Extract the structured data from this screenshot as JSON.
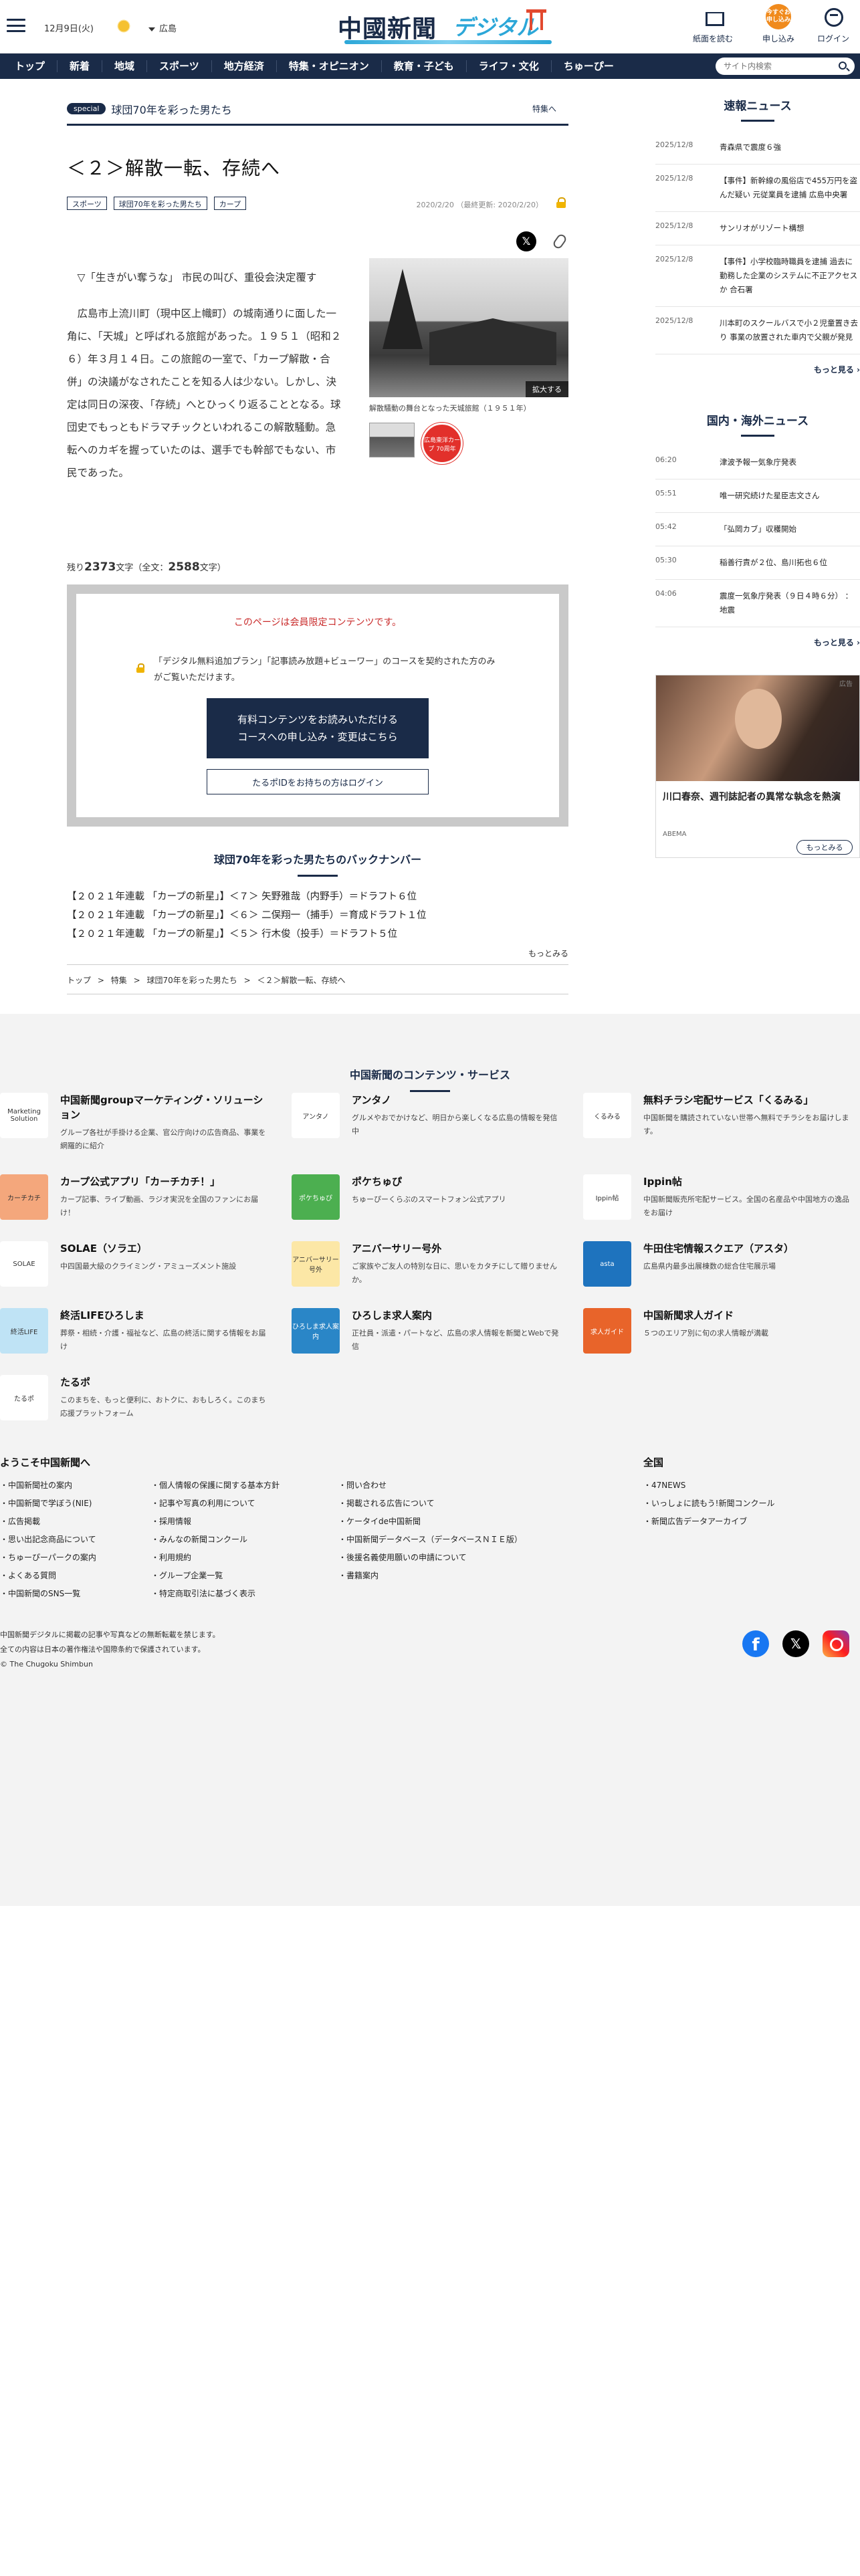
{
  "header": {
    "date": "12月9日(火)",
    "region": "広島",
    "logo_main": "中國新聞",
    "logo_sub": "デジタル",
    "btn_paper": "紙面を読む",
    "btn_apply": "申し込み",
    "apply_badge": "今すぐお申し込み",
    "btn_login": "ログイン"
  },
  "nav": {
    "items": [
      "トップ",
      "新着",
      "地域",
      "スポーツ",
      "地方経済",
      "特集・オピニオン",
      "教育・子ども",
      "ライフ・文化",
      "ちゅーぴー"
    ],
    "search_placeholder": "サイト内検索"
  },
  "article": {
    "special_badge": "special",
    "special_title": "球団70年を彩った男たち",
    "special_link": "特集へ",
    "title": "＜２＞解散一転、存続へ",
    "tags": [
      "スポーツ",
      "球団70年を彩った男たち",
      "カープ"
    ],
    "dates": "2020/2/20 （最終更新: 2020/2/20）",
    "share_x": "𝕏",
    "paragraphs": [
      "▽「生きがい奪うな」 市民の叫び、重役会決定覆す",
      "広島市上流川町（現中区上幟町）の城南通りに面した一角に、「天城」と呼ばれる旅館があった。１９５１（昭和２６）年３月１４日。この旅館の一室で、「カープ解散・合併」の決議がなされたことを知る人は少ない。しかし、決定は同日の深夜、「存続」へとひっくり返ることとなる。球団史でもっともドラマチックといわれるこの解散騒動。急転へのカギを握っていたのは、選手でも幹部でもない、市民であった。"
    ],
    "photo_enlarge": "拡大する",
    "photo_caption": "解散騒動の舞台となった天城旅館（１９５１年）",
    "thumb2_text": "広島東洋カープ 70周年",
    "remaining_prefix": "残り",
    "remaining_count": "2373",
    "remaining_mid": "文字（全文：",
    "total_count": "2588",
    "remaining_suffix": "文字）"
  },
  "paywall": {
    "members_only": "このページは会員限定コンテンツです。",
    "note": "「デジタル無料追加プラン」「記事読み放題+ビューワー」のコースを契約された方のみがご覧いただけます。",
    "primary_button": "有料コンテンツをお読みいただける\nコースへの申し込み・変更はこちら",
    "secondary_button": "たるポIDをお持ちの方はログイン"
  },
  "backnumber": {
    "title": "球団70年を彩った男たちのバックナンバー",
    "items": [
      "【２０２１年連載 「カープの新星」】＜７＞ 矢野雅哉（内野手）＝ドラフト６位",
      "【２０２１年連載 「カープの新星」】＜６＞ 二俣翔一（捕手）＝育成ドラフト１位",
      "【２０２１年連載 「カープの新星」】＜５＞ 行木俊（投手）＝ドラフト５位"
    ],
    "more": "もっとみる"
  },
  "breadcrumb": [
    "トップ",
    ">",
    "特集",
    ">",
    "球団70年を彩った男たち",
    ">",
    "＜２＞解散一転、存続へ"
  ],
  "sidebar": {
    "breaking_title": "速報ニュース",
    "breaking": [
      {
        "date": "2025/12/8",
        "title": "青森県で震度６強"
      },
      {
        "date": "2025/12/8",
        "title": "【事件】新幹線の風俗店で455万円を盗んだ疑い 元従業員を逮捕 広島中央署"
      },
      {
        "date": "2025/12/8",
        "title": "サンリオがリゾート構想"
      },
      {
        "date": "2025/12/8",
        "title": "【事件】小学校臨時職員を逮捕 過去に勤務した企業のシステムに不正アクセスか 合石署"
      },
      {
        "date": "2025/12/8",
        "title": "川本町のスクールバスで小２児童置き去り 事業の放置された車内で父親が発見"
      }
    ],
    "breaking_more": "もっと見る",
    "intl_title": "国内・海外ニュース",
    "intl": [
      {
        "date": "06:20",
        "title": "津波予報一気象庁発表"
      },
      {
        "date": "05:51",
        "title": "唯一研究続けた星臣志文さん"
      },
      {
        "date": "05:42",
        "title": "「弘岡カブ」収穫開始"
      },
      {
        "date": "05:30",
        "title": "稲善行責が２位、島川拓也６位"
      },
      {
        "date": "04:06",
        "title": "震度一気象庁発表（９日４時６分） ：地震"
      }
    ],
    "intl_more": "もっと見る",
    "ad_label": "広告",
    "ad_title": "川口春奈、週刊誌記者の異常な執念を熱演",
    "ad_source": "ABEMA",
    "ad_button": "もっとみる"
  },
  "services": {
    "title": "中国新聞のコンテンツ・サービス",
    "items": [
      {
        "name": "中国新聞groupマーケティング・ソリューション",
        "desc": "グループ各社が手掛ける企業、官公庁向けの広告商品、事業を網羅的に紹介",
        "icon": "Marketing Solution"
      },
      {
        "name": "アンタノ",
        "desc": "グルメやおでかけなど、明日から楽しくなる広島の情報を発信中",
        "icon": "アンタノ"
      },
      {
        "name": "無料チラシ宅配サービス「くるみる」",
        "desc": "中国新聞を購読されていない世帯へ無料でチラシをお届けします。",
        "icon": "くるみる"
      },
      {
        "name": "カープ公式アプリ「カーチカチ！」",
        "desc": "カープ記事、ライブ動画、ラジオ実況を全国のファンにお届け！",
        "icon": "カーチカチ"
      },
      {
        "name": "ポケちゅぴ",
        "desc": "ちゅーぴーくらぶのスマートフォン公式アプリ",
        "icon": "ポケちゅぴ"
      },
      {
        "name": "Ippin帖",
        "desc": "中国新聞販売所宅配サービス。全国の名産品や中国地方の逸品をお届け",
        "icon": "Ippin帖"
      },
      {
        "name": "SOLAE（ソラエ）",
        "desc": "中四国最大級のクライミング・アミューズメント施設",
        "icon": "SOLAE"
      },
      {
        "name": "アニバーサリー号外",
        "desc": "ご家族やご友人の特別な日に、思いをカタチにして贈りませんか。",
        "icon": "アニバーサリー号外"
      },
      {
        "name": "牛田住宅情報スクエア（アスタ）",
        "desc": "広島県内最多出展棟数の総合住宅展示場",
        "icon": "asta"
      },
      {
        "name": "終活LIFEひろしま",
        "desc": "葬祭・相続・介護・福祉など、広島の終活に関する情報をお届け",
        "icon": "終活LIFE"
      },
      {
        "name": "ひろしま求人案内",
        "desc": "正社員・派遣・パートなど、広島の求人情報を新聞とWebで発信",
        "icon": "ひろしま求人案内"
      },
      {
        "name": "中国新聞求人ガイド",
        "desc": "５つのエリア別に旬の求人情報が満載",
        "icon": "求人ガイド"
      },
      {
        "name": "たるポ",
        "desc": "このまちを、もっと便利に、おトクに、おもしろく。このまち応援プラットフォーム",
        "icon": "たるポ"
      }
    ]
  },
  "welcome": {
    "title": "ようこそ中国新聞へ",
    "col1": [
      "中国新聞社の案内",
      "中国新聞で学ぼう(NIE)",
      "広告掲載",
      "思い出記念商品について",
      "ちゅーぴーパークの案内",
      "よくある質問",
      "中国新聞のSNS一覧"
    ],
    "col2": [
      "個人情報の保護に関する基本方針",
      "記事や写真の利用について",
      "採用情報",
      "みんなの新聞コンクール",
      "利用規約",
      "グループ企業一覧",
      "特定商取引法に基づく表示"
    ],
    "col3": [
      "問い合わせ",
      "掲載される広告について",
      "ケータイde中国新聞",
      "中国新聞データベース（データベースＮＩＥ版）",
      "後援名義使用願いの申請について",
      "書籍案内"
    ],
    "zenkoku_title": "全国",
    "col4": [
      "47NEWS",
      "いっしょに読もう!新聞コンクール",
      "新聞広告データアーカイブ"
    ]
  },
  "footer": {
    "line1": "中国新聞デジタルに掲載の記事や写真などの無断転載を禁じます。",
    "line2": "全ての内容は日本の著作権法や国際条約で保護されています。",
    "line3": "© The Chugoku Shimbun",
    "fb": "f",
    "x": "𝕏"
  }
}
